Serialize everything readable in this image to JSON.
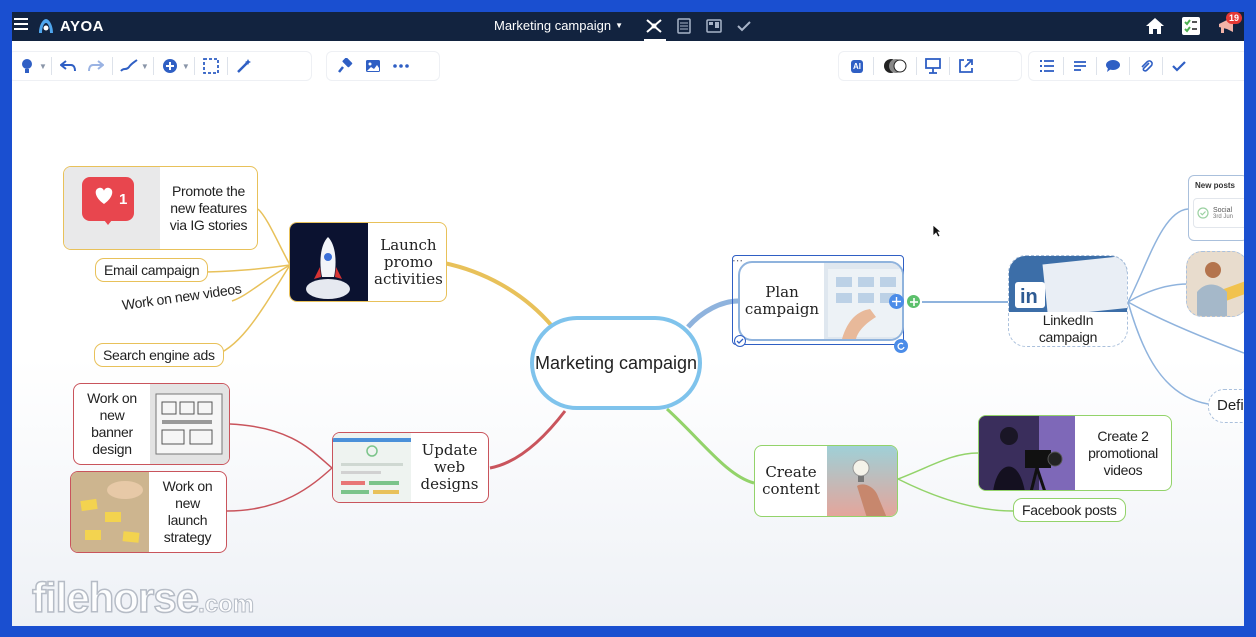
{
  "app": {
    "name": "AYOA"
  },
  "document": {
    "title": "Marketing campaign"
  },
  "notifications": {
    "count": "19"
  },
  "colors": {
    "navy": "#12233f",
    "accent": "#2f5fc4",
    "yellow_branch": "#e8c15a",
    "red_branch": "#c9545c",
    "green_branch": "#93d36a",
    "blue_branch": "#8fb3dd",
    "central_border": "#7fc3ec"
  },
  "icons": {
    "toolbar": [
      "lightbulb-icon",
      "undo-icon",
      "redo-icon",
      "pen-icon",
      "add-circle-icon",
      "select-area-icon",
      "magic-wand-icon",
      "format-painter-icon",
      "image-icon",
      "more-icon",
      "ai-icon",
      "theme-icon",
      "present-icon",
      "share-icon",
      "list-icon",
      "text-icon",
      "comment-icon",
      "attachment-icon",
      "check-icon"
    ]
  },
  "toolbar": {
    "ai_label": "AI"
  },
  "map": {
    "central": "Marketing campaign",
    "launch_promo": "Launch promo activities",
    "promote_ig": "Promote the new features via IG stories",
    "ig_like_count": "1",
    "email_campaign": "Email campaign",
    "work_new_videos": "Work on new videos",
    "search_ads": "Search engine ads",
    "update_web": "Update web designs",
    "banner_design": "Work on new banner design",
    "launch_strategy": "Work on new launch strategy",
    "plan_campaign": "Plan campaign",
    "linkedin_campaign": "LinkedIn campaign",
    "create_content": "Create content",
    "promo_videos": "Create 2 promotional videos",
    "facebook_posts": "Facebook posts",
    "def_partial": "Defi",
    "new_posts_card": {
      "header": "New posts",
      "item": "Social",
      "date": "3rd Jun"
    }
  },
  "watermark": {
    "main": "filehorse",
    "suffix": ".com"
  }
}
